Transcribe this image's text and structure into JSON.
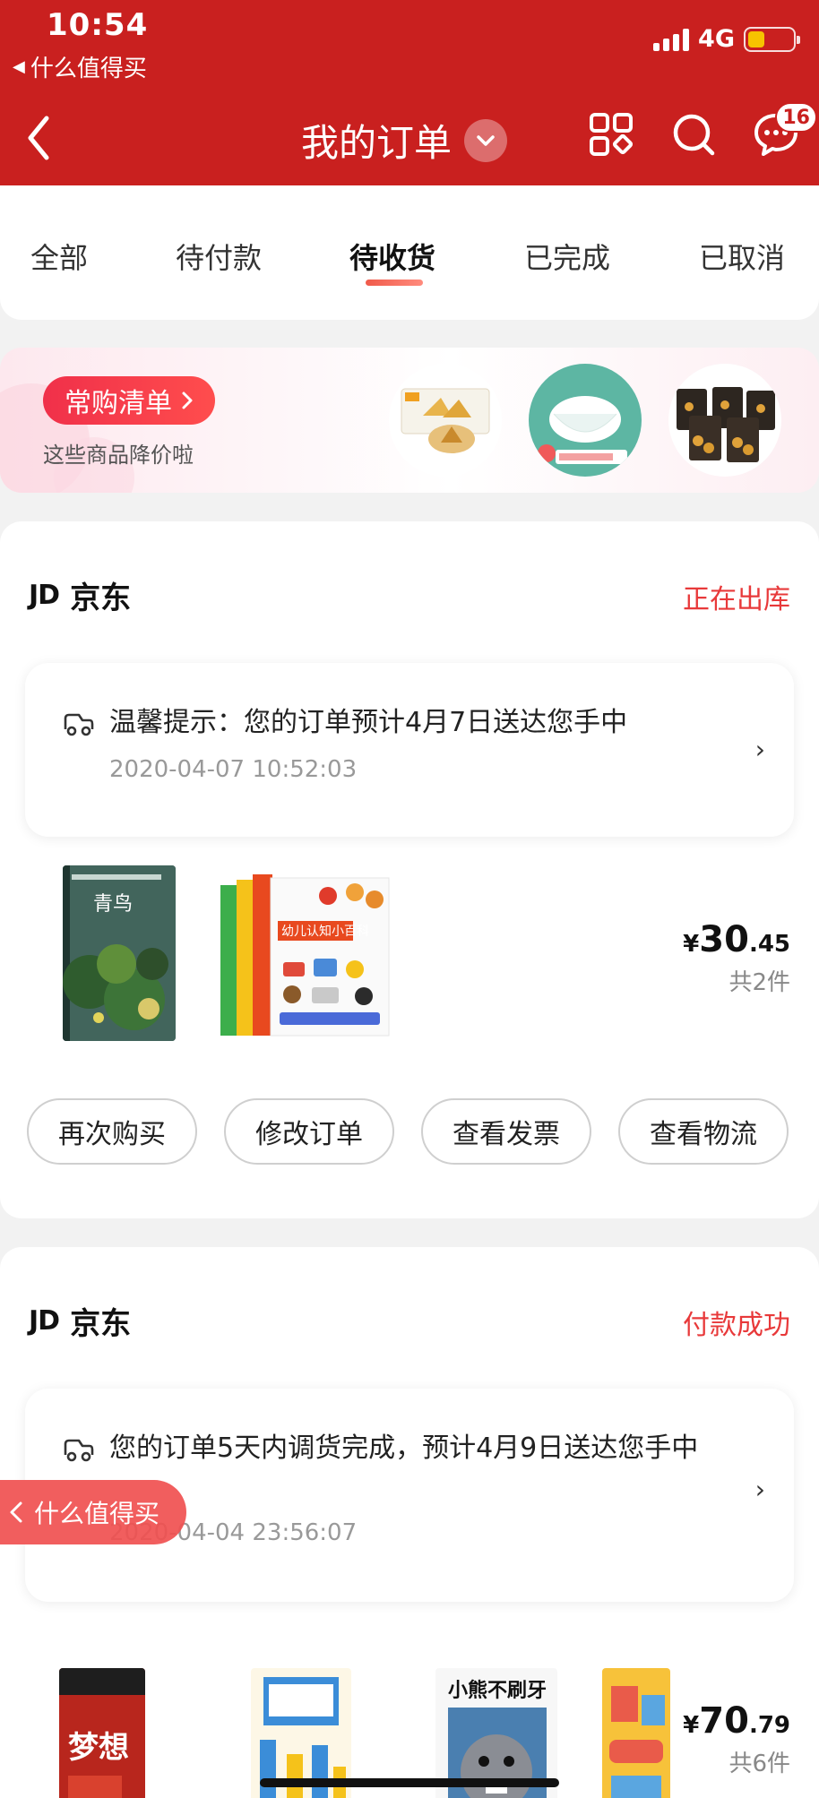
{
  "status_bar": {
    "time": "10:54",
    "back_app": "什么值得买",
    "network": "4G"
  },
  "nav": {
    "title": "我的订单",
    "message_badge": "16"
  },
  "tabs": [
    {
      "label": "全部"
    },
    {
      "label": "待付款"
    },
    {
      "label": "待收货",
      "active": true
    },
    {
      "label": "已完成"
    },
    {
      "label": "已取消"
    }
  ],
  "banner": {
    "pill": "常购清单",
    "subtitle": "这些商品降价啦"
  },
  "orders": [
    {
      "shop": "京东",
      "shop_logo": "JD",
      "status": "正在出库",
      "notice": "温馨提示：您的订单预计4月7日送达您手中",
      "notice_time": "2020-04-07 10:52:03",
      "price_symbol": "¥",
      "price_int": "30",
      "price_dec": ".45",
      "quantity": "共2件",
      "book1_title": "青鸟",
      "book2_title": "幼儿认知小百科",
      "buttons": [
        "再次购买",
        "修改订单",
        "查看发票",
        "查看物流"
      ]
    },
    {
      "shop": "京东",
      "shop_logo": "JD",
      "status": "付款成功",
      "notice": "您的订单5天内调货完成，预计4月9日送达您手中",
      "notice_time": "2020-04-04 23:56:07",
      "price_symbol": "¥",
      "price_int": "70",
      "price_dec": ".79",
      "quantity": "共6件",
      "book3_title": "梦想",
      "book5_title": "小熊不刷牙"
    }
  ],
  "floating_back": {
    "label": "什么值得买"
  },
  "colors": {
    "brand_red": "#c9201f",
    "status_red": "#e8393a"
  }
}
